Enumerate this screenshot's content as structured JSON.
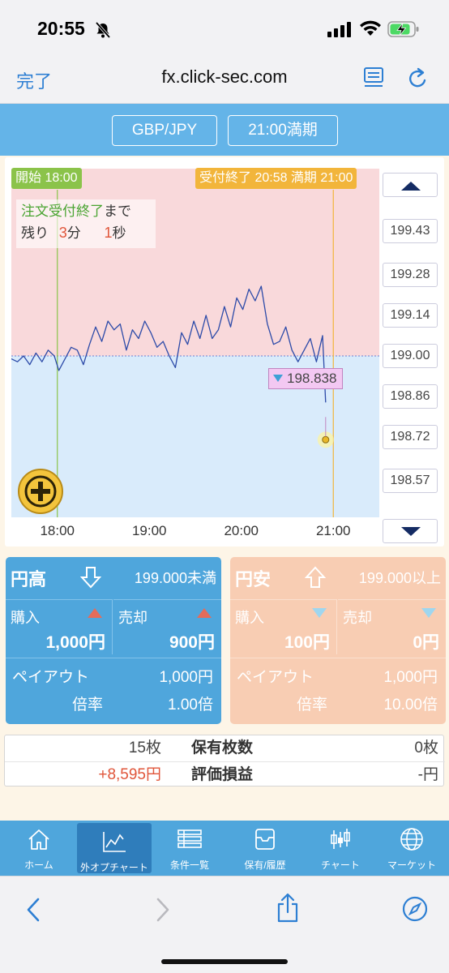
{
  "status": {
    "time": "20:55"
  },
  "browser": {
    "done": "完了",
    "url": "fx.click-sec.com"
  },
  "header": {
    "pair": "GBP/JPY",
    "expiry": "21:00満期"
  },
  "chart": {
    "start_tag": "開始 18:00",
    "end_tag": "受付終了 20:58 満期 21:00",
    "countdown": {
      "line1a": "注文受付終了",
      "line1b": "まで",
      "prefix": "残り",
      "minutes": "3",
      "min_unit": "分",
      "seconds": "1",
      "sec_unit": "秒"
    },
    "current_price": "198.838",
    "strike": "199.00"
  },
  "chart_data": {
    "type": "line",
    "x_ticks": [
      "18:00",
      "19:00",
      "20:00",
      "21:00"
    ],
    "y_ticks": [
      199.43,
      199.28,
      199.14,
      199.0,
      198.86,
      198.72,
      198.57
    ],
    "y_tick_labels": [
      "199.43",
      "199.28",
      "199.14",
      "199.00",
      "198.86",
      "198.72",
      "198.57"
    ],
    "ylim": [
      198.52,
      199.62
    ],
    "strike": 199.0,
    "start_time": "18:00",
    "accept_end_time": "20:58",
    "expiry_time": "21:00",
    "series": [
      {
        "points": [
          [
            "17:30",
            198.99
          ],
          [
            "17:34",
            198.98
          ],
          [
            "17:38",
            199.0
          ],
          [
            "17:42",
            198.97
          ],
          [
            "17:46",
            199.01
          ],
          [
            "17:50",
            198.98
          ],
          [
            "17:54",
            199.02
          ],
          [
            "17:58",
            199.0
          ],
          [
            "18:01",
            198.95
          ],
          [
            "18:05",
            198.99
          ],
          [
            "18:09",
            199.03
          ],
          [
            "18:13",
            199.02
          ],
          [
            "18:17",
            198.97
          ],
          [
            "18:21",
            199.04
          ],
          [
            "18:25",
            199.1
          ],
          [
            "18:29",
            199.05
          ],
          [
            "18:33",
            199.12
          ],
          [
            "18:37",
            199.09
          ],
          [
            "18:41",
            199.11
          ],
          [
            "18:45",
            199.02
          ],
          [
            "18:49",
            199.09
          ],
          [
            "18:53",
            199.06
          ],
          [
            "18:57",
            199.12
          ],
          [
            "19:01",
            199.08
          ],
          [
            "19:05",
            199.03
          ],
          [
            "19:09",
            199.05
          ],
          [
            "19:13",
            199.0
          ],
          [
            "19:17",
            198.96
          ],
          [
            "19:21",
            199.08
          ],
          [
            "19:25",
            199.04
          ],
          [
            "19:29",
            199.12
          ],
          [
            "19:33",
            199.06
          ],
          [
            "19:37",
            199.14
          ],
          [
            "19:41",
            199.06
          ],
          [
            "19:45",
            199.09
          ],
          [
            "19:49",
            199.17
          ],
          [
            "19:53",
            199.1
          ],
          [
            "19:57",
            199.2
          ],
          [
            "20:01",
            199.16
          ],
          [
            "20:05",
            199.23
          ],
          [
            "20:09",
            199.19
          ],
          [
            "20:13",
            199.24
          ],
          [
            "20:17",
            199.11
          ],
          [
            "20:21",
            199.04
          ],
          [
            "20:25",
            199.05
          ],
          [
            "20:29",
            199.1
          ],
          [
            "20:33",
            199.02
          ],
          [
            "20:37",
            198.98
          ],
          [
            "20:41",
            199.02
          ],
          [
            "20:45",
            199.06
          ],
          [
            "20:49",
            198.98
          ],
          [
            "20:53",
            199.07
          ],
          [
            "20:55",
            198.84
          ]
        ]
      }
    ]
  },
  "trade": {
    "down": {
      "title": "円高",
      "condition": "199.000未満",
      "buy_label": "購入",
      "buy_value": "1,000円",
      "sell_label": "売却",
      "sell_value": "900円",
      "payout_label": "ペイアウト",
      "payout_value": "1,000円",
      "rate_label": "倍率",
      "rate_value": "1.00倍"
    },
    "up": {
      "title": "円安",
      "condition": "199.000以上",
      "buy_label": "購入",
      "buy_value": "100円",
      "sell_label": "売却",
      "sell_value": "0円",
      "payout_label": "ペイアウト",
      "payout_value": "1,000円",
      "rate_label": "倍率",
      "rate_value": "10.00倍"
    }
  },
  "holdings": {
    "left_count": "15枚",
    "count_label": "保有枚数",
    "right_count": "0枚",
    "left_pl": "+8,595円",
    "pl_label": "評価損益",
    "right_pl": "-円"
  },
  "tabs": [
    "ホーム",
    "外オプチャート",
    "条件一覧",
    "保有/履歴",
    "チャート",
    "マーケット"
  ],
  "colors": {
    "accent": "#4fa6dc",
    "down_zone": "#d9ebfb",
    "up_zone": "#f9d9db",
    "profit": "#e0553a",
    "strike_line": "#6b7fd0"
  }
}
